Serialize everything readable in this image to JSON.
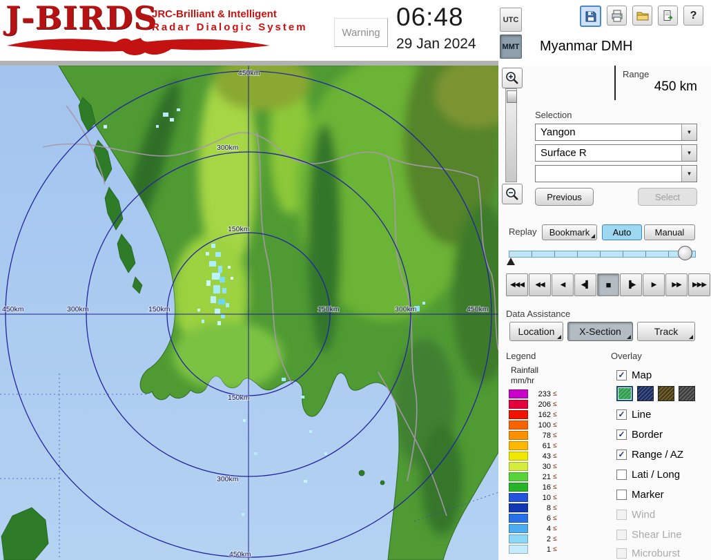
{
  "header": {
    "logo": {
      "title": "J-BIRDS",
      "tagline1": "JRC-Brilliant & Intelligent",
      "tagline2": "Radar  Dialogic  System"
    },
    "warning": "Warning",
    "time": "06:48",
    "date": "29 Jan 2024",
    "timezone": {
      "utc": "UTC",
      "mmt": "MMT",
      "selected": "MMT"
    },
    "station": "Myanmar DMH",
    "toolbar_icons": [
      "save-icon",
      "print-icon",
      "open-folder-icon",
      "export-icon",
      "help-icon"
    ],
    "help_glyph": "?"
  },
  "panel": {
    "range": {
      "label": "Range",
      "value": "450 km"
    },
    "selection": {
      "label": "Selection",
      "dropdowns": [
        {
          "value": "Yangon"
        },
        {
          "value": "Surface R"
        },
        {
          "value": ""
        }
      ],
      "previous": "Previous",
      "select": "Select"
    },
    "replay": {
      "label": "Replay",
      "bookmark": "Bookmark",
      "auto": "Auto",
      "manual": "Manual",
      "auto_color": "#9ed8f0",
      "mode": "Auto"
    },
    "playback": [
      {
        "name": "rewind-fast",
        "glyph": "◀◀◀"
      },
      {
        "name": "rewind",
        "glyph": "◀◀"
      },
      {
        "name": "play-reverse",
        "glyph": "◀"
      },
      {
        "name": "step-back",
        "glyph": "◀▌"
      },
      {
        "name": "stop",
        "glyph": "■"
      },
      {
        "name": "step-forward",
        "glyph": "▐▶"
      },
      {
        "name": "play",
        "glyph": "▶"
      },
      {
        "name": "forward",
        "glyph": "▶▶"
      },
      {
        "name": "forward-fast",
        "glyph": "▶▶▶"
      }
    ],
    "data_assistance": {
      "label": "Data Assistance",
      "buttons": [
        {
          "label": "Location"
        },
        {
          "label": "X-Section"
        },
        {
          "label": "Track"
        }
      ],
      "pressed": "X-Section"
    },
    "legend": {
      "label": "Legend",
      "unit_line1": "Rainfall",
      "unit_line2": "mm/hr",
      "leq": "≤",
      "entries": [
        {
          "value": "233",
          "color": "#c800c8"
        },
        {
          "value": "206",
          "color": "#e4003c"
        },
        {
          "value": "162",
          "color": "#f01400"
        },
        {
          "value": "100",
          "color": "#f86400"
        },
        {
          "value": "78",
          "color": "#fb9000"
        },
        {
          "value": "61",
          "color": "#fcb800"
        },
        {
          "value": "43",
          "color": "#f0e800"
        },
        {
          "value": "30",
          "color": "#d4ec40"
        },
        {
          "value": "21",
          "color": "#58d438"
        },
        {
          "value": "16",
          "color": "#28b428"
        },
        {
          "value": "10",
          "color": "#2454dc"
        },
        {
          "value": "8",
          "color": "#1238b4"
        },
        {
          "value": "6",
          "color": "#2870e8"
        },
        {
          "value": "4",
          "color": "#4cacf0"
        },
        {
          "value": "2",
          "color": "#8cd8f8"
        },
        {
          "value": "1",
          "color": "#c4ecfc"
        }
      ]
    },
    "overlay": {
      "label": "Overlay",
      "check_glyph": "✓",
      "items": [
        {
          "label": "Map",
          "checked": true,
          "enabled": true
        },
        {
          "label": "Line",
          "checked": true,
          "enabled": true
        },
        {
          "label": "Border",
          "checked": true,
          "enabled": true
        },
        {
          "label": "Range / AZ",
          "checked": true,
          "enabled": true
        },
        {
          "label": "Lati / Long",
          "checked": false,
          "enabled": true
        },
        {
          "label": "Marker",
          "checked": false,
          "enabled": true
        },
        {
          "label": "Wind",
          "checked": false,
          "enabled": false
        },
        {
          "label": "Shear Line",
          "checked": false,
          "enabled": false
        },
        {
          "label": "Microburst",
          "checked": false,
          "enabled": false
        }
      ],
      "map_styles": [
        {
          "name": "terrain-green",
          "color": "#2f9e4e",
          "selected": true
        },
        {
          "name": "dark-blue",
          "color": "#1b2d62",
          "selected": false
        },
        {
          "name": "dark-olive",
          "color": "#4e3f12",
          "selected": false
        },
        {
          "name": "dark-gray",
          "color": "#3f3f3f",
          "selected": false
        }
      ]
    }
  },
  "map": {
    "range_labels": [
      "450km",
      "300km",
      "150km",
      "150km",
      "300km",
      "450km",
      "450km",
      "300km",
      "150km",
      "150km",
      "300km",
      "450km"
    ],
    "sea_color": "#a4c6ee",
    "land_color": "#4f9a33",
    "ring_color": "#2222a0"
  }
}
